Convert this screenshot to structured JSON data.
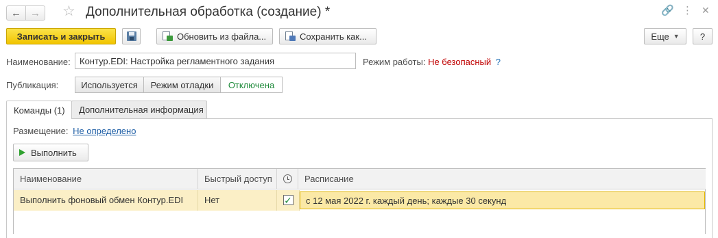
{
  "window": {
    "title": "Дополнительная обработка (создание) *",
    "nav_back_icon": "arrow-left-icon",
    "nav_forward_icon": "arrow-right-icon",
    "favorite_icon": "star-icon",
    "link_icon": "link-icon",
    "menu_icon": "more-vertical-icon",
    "close_icon": "close-icon"
  },
  "toolbar": {
    "save_close_label": "Записать и закрыть",
    "save_icon": "floppy-disk-icon",
    "update_from_file_label": "Обновить из файла...",
    "save_as_label": "Сохранить как...",
    "more_label": "Еще",
    "help_label": "?"
  },
  "form": {
    "name_label": "Наименование:",
    "name_value": "Контур.EDI: Настройка регламентного задания",
    "mode_label": "Режим работы:",
    "mode_value": "Не безопасный",
    "mode_help": "?",
    "publication_label": "Публикация:",
    "publication_options": [
      "Используется",
      "Режим отладки",
      "Отключена"
    ],
    "publication_selected": "Отключена"
  },
  "tabs": [
    {
      "label": "Команды (1)",
      "active": true
    },
    {
      "label": "Дополнительная информация",
      "active": false
    }
  ],
  "commands": {
    "placement_label": "Размещение:",
    "placement_value": "Не определено",
    "run_label": "Выполнить",
    "grid": {
      "headers": {
        "name": "Наименование",
        "quick_access": "Быстрый доступ",
        "scheduled_icon": "clock-icon",
        "schedule": "Расписание"
      },
      "rows": [
        {
          "name": "Выполнить фоновый обмен Контур.EDI",
          "quick_access": "Нет",
          "scheduled": true,
          "schedule": "с 12 мая 2022 г. каждый день; каждые 30 секунд"
        }
      ]
    }
  },
  "colors": {
    "primary_button": "#f1c400",
    "selected_row": "#fbefc6",
    "warning_text": "#c00000",
    "active_option": "#1e8a3a",
    "link": "#1f5fa6"
  }
}
